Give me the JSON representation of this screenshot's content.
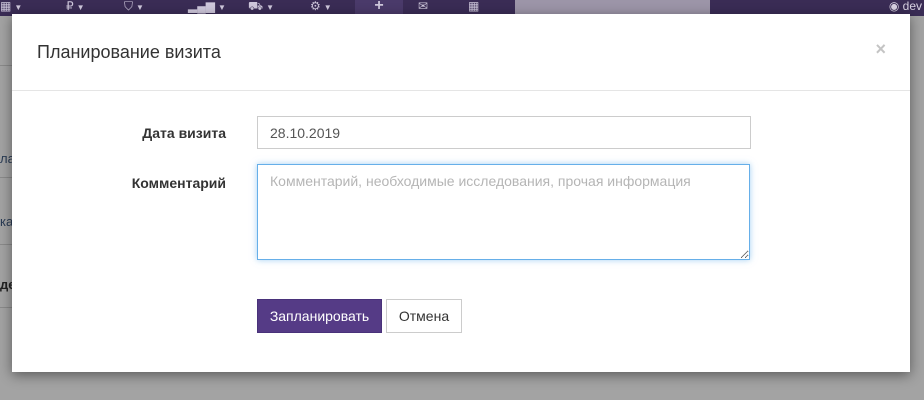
{
  "navbar": {
    "items": [
      {
        "icon": "grid-icon",
        "glyph": "▦"
      },
      {
        "icon": "ruble-icon",
        "glyph": "₽"
      },
      {
        "icon": "bag-icon",
        "glyph": "⛉"
      },
      {
        "icon": "bar-chart-icon",
        "glyph": "▂▄▆"
      },
      {
        "icon": "cart-icon",
        "glyph": "⛟"
      },
      {
        "icon": "gear-icon",
        "glyph": "⚙"
      },
      {
        "icon": "plus-icon",
        "glyph": "+"
      },
      {
        "icon": "envelope-icon",
        "glyph": "✉"
      },
      {
        "icon": "calendar-icon",
        "glyph": "▦"
      }
    ],
    "user_label": "dev",
    "user_icon": "user-icon"
  },
  "background": {
    "fragments": [
      "ла",
      "ка",
      "де"
    ]
  },
  "modal": {
    "title": "Планирование визита",
    "close_glyph": "×",
    "fields": {
      "date_label": "Дата визита",
      "date_value": "28.10.2019",
      "comment_label": "Комментарий",
      "comment_placeholder": "Комментарий, необходимые исследования, прочая информация",
      "comment_value": ""
    },
    "buttons": {
      "submit_label": "Запланировать",
      "cancel_label": "Отмена"
    }
  },
  "colors": {
    "navbar": "#3a2c55",
    "primary_button": "#553b86",
    "focus_border": "#66afe9"
  }
}
